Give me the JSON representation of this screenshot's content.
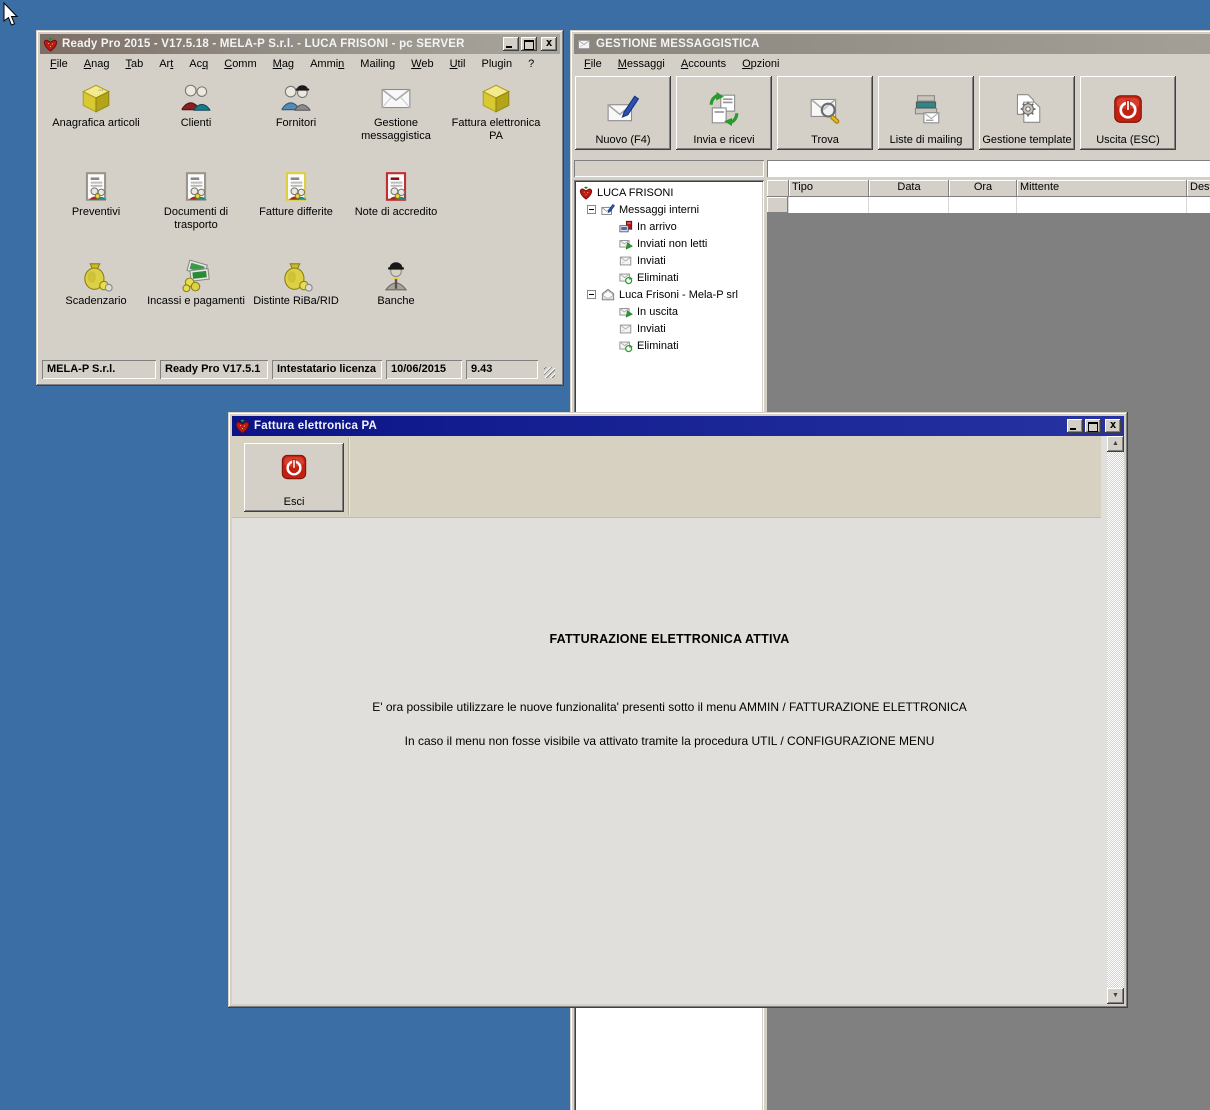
{
  "colors": {
    "desktop_bg": "#3A6EA5",
    "chrome": "#d4d0c8",
    "active_title": "#0b1487",
    "inactive_title_left": "#7e6e65",
    "message_list_bg": "#808080",
    "exit_red": "#c22010"
  },
  "ready_pro": {
    "title": "Ready Pro 2015 - V17.5.18 - MELA-P S.r.l. - LUCA FRISONI - pc SERVER",
    "menu": [
      {
        "label": "File",
        "u": 0
      },
      {
        "label": "Anag",
        "u": 0
      },
      {
        "label": "Tab",
        "u": 0
      },
      {
        "label": "Art",
        "u": 2
      },
      {
        "label": "Acq",
        "u": 2
      },
      {
        "label": "Comm",
        "u": 0
      },
      {
        "label": "Mag",
        "u": 0
      },
      {
        "label": "Ammin",
        "u": 4
      },
      {
        "label": "Mailing",
        "u": 6
      },
      {
        "label": "Web",
        "u": 0
      },
      {
        "label": "Util",
        "u": 0
      },
      {
        "label": "Plugin",
        "u": null
      },
      {
        "label": "?",
        "u": null
      }
    ],
    "icons": [
      {
        "label": "Anagrafica articoli",
        "icon": "box-icon",
        "row": 1,
        "col": 1
      },
      {
        "label": "Clienti",
        "icon": "clients-icon",
        "row": 1,
        "col": 2
      },
      {
        "label": "Fornitori",
        "icon": "suppliers-icon",
        "row": 1,
        "col": 3
      },
      {
        "label": "Gestione messaggistica",
        "icon": "envelope-icon",
        "row": 1,
        "col": 4
      },
      {
        "label": "Fattura elettronica PA",
        "icon": "cube-icon",
        "row": 1,
        "col": 5
      },
      {
        "label": "Preventivi",
        "icon": "doc-people-gray-icon",
        "row": 2,
        "col": 1
      },
      {
        "label": "Documenti di trasporto",
        "icon": "doc-people-gray-icon",
        "row": 2,
        "col": 2
      },
      {
        "label": "Fatture differite",
        "icon": "doc-people-yellow-icon",
        "row": 2,
        "col": 3
      },
      {
        "label": "Note di accredito",
        "icon": "doc-people-red-icon",
        "row": 2,
        "col": 4
      },
      {
        "label": "Scadenzario",
        "icon": "money-bag-icon",
        "row": 3,
        "col": 1
      },
      {
        "label": "Incassi e pagamenti",
        "icon": "money-stack-icon",
        "row": 3,
        "col": 2
      },
      {
        "label": "Distinte RiBa/RID",
        "icon": "money-bag-icon",
        "row": 3,
        "col": 3
      },
      {
        "label": "Banche",
        "icon": "banker-icon",
        "row": 3,
        "col": 4
      }
    ],
    "statusbar": [
      "MELA-P S.r.l.",
      "Ready Pro V17.5.1",
      "Intestatario licenza",
      "10/06/2015",
      "9.43"
    ]
  },
  "messaging": {
    "title": "GESTIONE MESSAGGISTICA",
    "menu": [
      {
        "label": "File",
        "u": 0
      },
      {
        "label": "Messaggi",
        "u": 0
      },
      {
        "label": "Accounts",
        "u": 0
      },
      {
        "label": "Opzioni",
        "u": 0
      }
    ],
    "toolbar": [
      {
        "label": "Nuovo (F4)",
        "icon": "new-mail-icon"
      },
      {
        "label": "Invia e ricevi",
        "icon": "send-receive-icon"
      },
      {
        "label": "Trova",
        "icon": "find-mail-icon"
      },
      {
        "label": "Liste di mailing",
        "icon": "mailing-lists-icon"
      },
      {
        "label": "Gestione template",
        "icon": "templates-icon"
      },
      {
        "label": "Uscita (ESC)",
        "icon": "power-icon"
      }
    ],
    "tree": {
      "root": {
        "label": "LUCA FRISONI",
        "icon": "strawberry-icon"
      },
      "groups": [
        {
          "label": "Messaggi interni",
          "icon": "envelope-pen-icon",
          "items": [
            {
              "label": "In arrivo",
              "icon": "inbox-icon"
            },
            {
              "label": "Inviati non letti",
              "icon": "envelope-arrow-icon"
            },
            {
              "label": "Inviati",
              "icon": "envelope-plain-icon"
            },
            {
              "label": "Eliminati",
              "icon": "envelope-recycle-icon"
            }
          ]
        },
        {
          "label": "Luca Frisoni - Mela-P srl",
          "icon": "envelope-open-icon",
          "items": [
            {
              "label": "In uscita",
              "icon": "envelope-arrow-icon"
            },
            {
              "label": "Inviati",
              "icon": "envelope-plain-icon"
            },
            {
              "label": "Eliminati",
              "icon": "envelope-recycle-icon"
            }
          ]
        }
      ]
    },
    "table": {
      "columns": [
        "",
        "Tipo",
        "Data",
        "Ora",
        "Mittente",
        "Destinatario"
      ]
    }
  },
  "fattura": {
    "title": "Fattura elettronica PA",
    "exit_label": "Esci",
    "heading": "FATTURAZIONE ELETTRONICA ATTIVA",
    "line1": "E' ora possibile utilizzare le nuove funzionalita' presenti sotto il menu AMMIN / FATTURAZIONE ELETTRONICA",
    "line2": "In caso il menu non fosse visibile va attivato tramite la procedura UTIL / CONFIGURAZIONE MENU"
  }
}
